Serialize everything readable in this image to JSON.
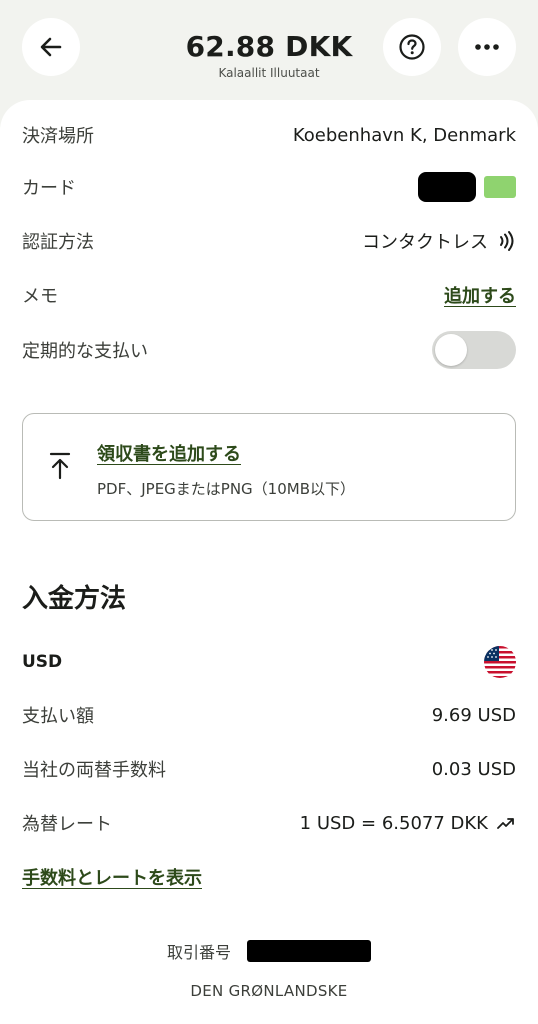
{
  "header": {
    "amount": "62.88 DKK",
    "merchant_name": "Kalaallit Illuutaat",
    "back_icon": "arrow-left-icon",
    "help_icon": "question-circle-icon",
    "more_icon": "more-horizontal-icon"
  },
  "details": {
    "location_label": "決済場所",
    "location_value": "Koebenhavn K, Denmark",
    "card_label": "カード",
    "auth_label": "認証方法",
    "auth_value": "コンタクトレス",
    "auth_icon": "contactless-icon",
    "memo_label": "メモ",
    "memo_action": "追加する",
    "recurring_label": "定期的な支払い",
    "recurring_enabled": false
  },
  "receipt": {
    "title": "領収書を追加する",
    "subtitle": "PDF、JPEGまたはPNG（10MB以下）",
    "icon": "upload-icon"
  },
  "payment_method": {
    "section_title": "入金方法",
    "currency": "USD",
    "currency_flag": "us-flag-icon",
    "amount_label": "支払い額",
    "amount_value": "9.69 USD",
    "fee_label": "当社の両替手数料",
    "fee_value": "0.03 USD",
    "rate_label": "為替レート",
    "rate_value": "1 USD = 6.5077 DKK",
    "rate_icon": "trending-up-icon",
    "show_fees_link": "手数料とレートを表示"
  },
  "footer": {
    "reference_label": "取引番号",
    "merchant_descriptor": "DEN GRØNLANDSKE"
  },
  "colors": {
    "background": "#f2f3ef",
    "accent_green": "#2d4a1a",
    "card_chip": "#8fd36f",
    "toggle_off": "#d8d9d6"
  }
}
